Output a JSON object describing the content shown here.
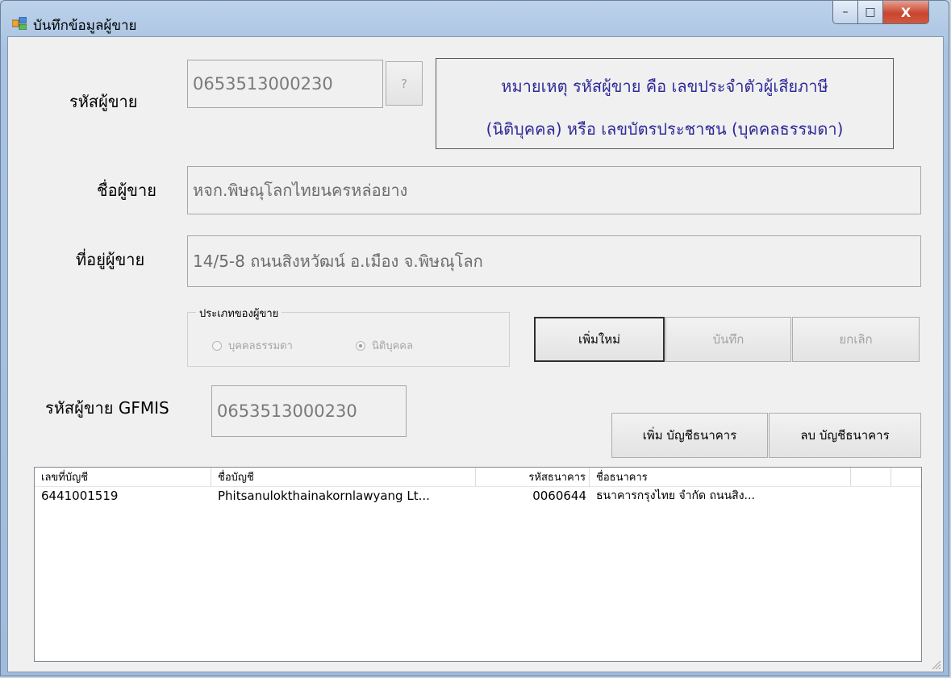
{
  "window": {
    "title": "บันทึกข้อมูลผู้ขาย",
    "controls": {
      "minimize": "–",
      "maximize": "□",
      "close": "X"
    }
  },
  "form": {
    "seller_code_label": "รหัสผู้ขาย",
    "seller_code_value": "0653513000230",
    "lookup_button": "?",
    "note_line1": "หมายเหตุ รหัสผู้ขาย คือ เลขประจำตัวผู้เสียภาษี",
    "note_line2": "(นิติบุคคล) หรือ เลขบัตรประชาชน (บุคคลธรรมดา)",
    "seller_name_label": "ชื่อผู้ขาย",
    "seller_name_value": "หจก.พิษณุโลกไทยนครหล่อยาง",
    "seller_address_label": "ที่อยู่ผู้ขาย",
    "seller_address_value": "14/5-8 ถนนสิงหวัฒน์ อ.เมือง จ.พิษณุโลก",
    "seller_type": {
      "legend": "ประเภทของผู้ขาย",
      "options": [
        {
          "label": "บุคคลธรรมดา",
          "selected": false
        },
        {
          "label": "นิติบุคคล",
          "selected": true
        }
      ]
    },
    "buttons": {
      "new": "เพิ่มใหม่",
      "save": "บันทึก",
      "cancel": "ยกเลิก"
    },
    "gfmis_label": "รหัสผู้ขาย GFMIS",
    "gfmis_value": "0653513000230",
    "bank_buttons": {
      "add": "เพิ่ม บัญชีธนาคาร",
      "delete": "ลบ บัญชีธนาคาร"
    }
  },
  "accounts_table": {
    "columns": [
      "เลขที่บัญชี",
      "ชื่อบัญชี",
      "รหัสธนาคาร",
      "ชื่อธนาคาร"
    ],
    "rows": [
      [
        "6441001519",
        "Phitsanulokthainakornlawyang Lt...",
        "0060644",
        "ธนาคารกรุงไทย จำกัด ถนนสิง..."
      ]
    ]
  },
  "icons": {
    "app": "form-window-icon",
    "resize": "resize-grip-icon"
  },
  "colors": {
    "note_text": "#2f2a98",
    "close_button": "#c9452f"
  }
}
